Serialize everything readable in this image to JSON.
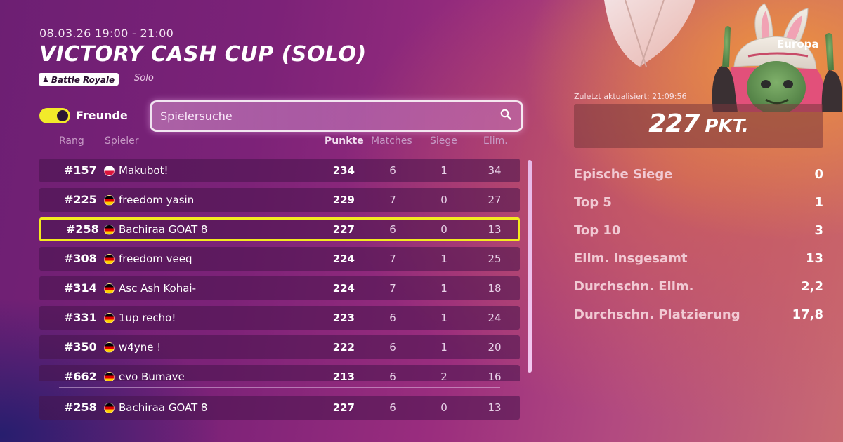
{
  "event": {
    "date": "08.03.26 19:00 - 21:00",
    "title": "VICTORY CASH CUP (SOLO)",
    "mode_badge": "Battle Royale",
    "mode_type": "Solo"
  },
  "controls": {
    "friends_toggle_label": "Freunde",
    "friends_toggle_on": true,
    "search_placeholder": "Spielersuche"
  },
  "table": {
    "headers": {
      "rank": "Rang",
      "player": "Spieler",
      "points": "Punkte",
      "matches": "Matches",
      "wins": "Siege",
      "elims": "Elim."
    },
    "rows": [
      {
        "rank": "#157",
        "flag": "pl",
        "name": "Makubot!",
        "points": "234",
        "matches": "6",
        "wins": "1",
        "elims": "34"
      },
      {
        "rank": "#225",
        "flag": "de",
        "name": "freedom yasin",
        "points": "229",
        "matches": "7",
        "wins": "0",
        "elims": "27"
      },
      {
        "rank": "#258",
        "flag": "de",
        "name": "Bachiraa GOAT 8",
        "points": "227",
        "matches": "6",
        "wins": "0",
        "elims": "13"
      },
      {
        "rank": "#308",
        "flag": "de",
        "name": "freedom veeq",
        "points": "224",
        "matches": "7",
        "wins": "1",
        "elims": "25"
      },
      {
        "rank": "#314",
        "flag": "de",
        "name": "Asc Ash Kohai-",
        "points": "224",
        "matches": "7",
        "wins": "1",
        "elims": "18"
      },
      {
        "rank": "#331",
        "flag": "de",
        "name": "1up recho!",
        "points": "223",
        "matches": "6",
        "wins": "1",
        "elims": "24"
      },
      {
        "rank": "#350",
        "flag": "de",
        "name": "w4yne !",
        "points": "222",
        "matches": "6",
        "wins": "1",
        "elims": "20"
      },
      {
        "rank": "#662",
        "flag": "de",
        "name": "evo Bumave",
        "points": "213",
        "matches": "6",
        "wins": "2",
        "elims": "16"
      }
    ],
    "highlighted_row_index": 2,
    "pinned_row": {
      "rank": "#258",
      "flag": "de",
      "name": "Bachiraa GOAT 8",
      "points": "227",
      "matches": "6",
      "wins": "0",
      "elims": "13"
    }
  },
  "profile": {
    "region": "Europa",
    "updated": "Zuletzt aktualisiert: 21:09:56",
    "score_value": "227",
    "score_unit": "PKT.",
    "stats": [
      {
        "label": "Epische Siege",
        "value": "0"
      },
      {
        "label": "Top 5",
        "value": "1"
      },
      {
        "label": "Top 10",
        "value": "3"
      },
      {
        "label": "Elim. insgesamt",
        "value": "13"
      },
      {
        "label": "Durchschn. Elim.",
        "value": "2,2"
      },
      {
        "label": "Durchschn. Platzierung",
        "value": "17,8"
      }
    ]
  },
  "colors": {
    "highlight": "#f3ea1f",
    "toggle_on": "#f2ea2a"
  },
  "icons": {
    "search": "magnifier-icon",
    "mode": "battle-royale-icon"
  }
}
